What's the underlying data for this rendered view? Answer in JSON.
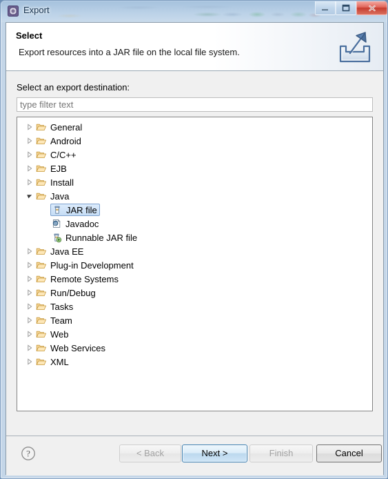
{
  "window": {
    "title": "Export",
    "icon": "eclipse-export-icon",
    "controls": {
      "minimize_label": "Minimize",
      "maximize_label": "Maximize",
      "close_label": "Close"
    }
  },
  "header": {
    "title": "Select",
    "description": "Export resources into a JAR file on the local file system.",
    "icon": "export-wizard-icon"
  },
  "body": {
    "destination_label": "Select an export destination:",
    "filter": {
      "value": "",
      "placeholder": "type filter text"
    },
    "tree": [
      {
        "label": "General",
        "icon": "folder-icon",
        "indent": 0,
        "expandable": true,
        "expanded": false,
        "selected": false
      },
      {
        "label": "Android",
        "icon": "folder-icon",
        "indent": 0,
        "expandable": true,
        "expanded": false,
        "selected": false
      },
      {
        "label": "C/C++",
        "icon": "folder-icon",
        "indent": 0,
        "expandable": true,
        "expanded": false,
        "selected": false
      },
      {
        "label": "EJB",
        "icon": "folder-icon",
        "indent": 0,
        "expandable": true,
        "expanded": false,
        "selected": false
      },
      {
        "label": "Install",
        "icon": "folder-icon",
        "indent": 0,
        "expandable": true,
        "expanded": false,
        "selected": false
      },
      {
        "label": "Java",
        "icon": "folder-icon",
        "indent": 0,
        "expandable": true,
        "expanded": true,
        "selected": false
      },
      {
        "label": "JAR file",
        "icon": "jar-file-icon",
        "indent": 1,
        "expandable": false,
        "expanded": false,
        "selected": true
      },
      {
        "label": "Javadoc",
        "icon": "javadoc-icon",
        "indent": 1,
        "expandable": false,
        "expanded": false,
        "selected": false
      },
      {
        "label": "Runnable JAR file",
        "icon": "runnable-jar-icon",
        "indent": 1,
        "expandable": false,
        "expanded": false,
        "selected": false
      },
      {
        "label": "Java EE",
        "icon": "folder-icon",
        "indent": 0,
        "expandable": true,
        "expanded": false,
        "selected": false
      },
      {
        "label": "Plug-in Development",
        "icon": "folder-icon",
        "indent": 0,
        "expandable": true,
        "expanded": false,
        "selected": false
      },
      {
        "label": "Remote Systems",
        "icon": "folder-icon",
        "indent": 0,
        "expandable": true,
        "expanded": false,
        "selected": false
      },
      {
        "label": "Run/Debug",
        "icon": "folder-icon",
        "indent": 0,
        "expandable": true,
        "expanded": false,
        "selected": false
      },
      {
        "label": "Tasks",
        "icon": "folder-icon",
        "indent": 0,
        "expandable": true,
        "expanded": false,
        "selected": false
      },
      {
        "label": "Team",
        "icon": "folder-icon",
        "indent": 0,
        "expandable": true,
        "expanded": false,
        "selected": false
      },
      {
        "label": "Web",
        "icon": "folder-icon",
        "indent": 0,
        "expandable": true,
        "expanded": false,
        "selected": false
      },
      {
        "label": "Web Services",
        "icon": "folder-icon",
        "indent": 0,
        "expandable": true,
        "expanded": false,
        "selected": false
      },
      {
        "label": "XML",
        "icon": "folder-icon",
        "indent": 0,
        "expandable": true,
        "expanded": false,
        "selected": false
      }
    ]
  },
  "footer": {
    "help_icon": "help-question-icon",
    "buttons": [
      {
        "id": "back",
        "label": "< Back",
        "state": "disabled"
      },
      {
        "id": "next",
        "label": "Next >",
        "state": "default"
      },
      {
        "id": "finish",
        "label": "Finish",
        "state": "disabled"
      },
      {
        "id": "cancel",
        "label": "Cancel",
        "state": "normal"
      }
    ]
  },
  "colors": {
    "accent": "#3c7fb1",
    "selection_fill": "#c6ddf5",
    "selection_border": "#7da2ce",
    "folder": "#f5c97a",
    "close_button": "#c63c2e"
  }
}
